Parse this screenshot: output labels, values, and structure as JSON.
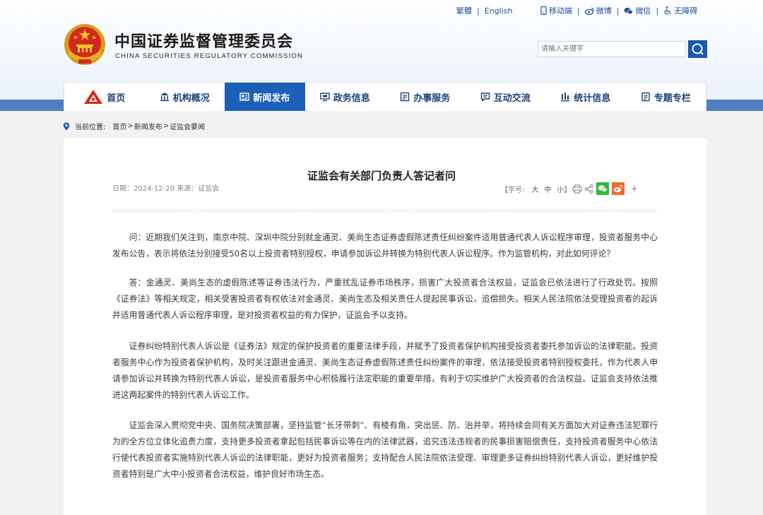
{
  "top_links": {
    "traditional": "繁體",
    "english": "English",
    "mobile": "移动端",
    "weibo": "微博",
    "wechat": "微信",
    "accessibility": "无障碍"
  },
  "site": {
    "title": "中国证券监督管理委员会",
    "subtitle": "CHINA SECURITIES REGULATORY COMMISSION"
  },
  "search": {
    "placeholder": "请输入关键字"
  },
  "nav": [
    {
      "label": "首页",
      "icon": "home-logo-icon"
    },
    {
      "label": "机构概况",
      "icon": "building-icon"
    },
    {
      "label": "新闻发布",
      "icon": "news-icon",
      "active": true
    },
    {
      "label": "政务信息",
      "icon": "monitor-icon"
    },
    {
      "label": "办事服务",
      "icon": "service-icon"
    },
    {
      "label": "互动交流",
      "icon": "chat-icon"
    },
    {
      "label": "统计信息",
      "icon": "bar-chart-icon"
    },
    {
      "label": "专题专栏",
      "icon": "document-icon"
    }
  ],
  "breadcrumb": {
    "prefix": "当前位置:",
    "home": "首页",
    "sep1": ">",
    "news": "新闻发布",
    "sep2": ">",
    "current": "证监会要闻"
  },
  "article": {
    "title": "证监会有关部门负责人答记者问",
    "meta": "日期：2024-12-20 来源：证监会",
    "font_size_label": "【字号:",
    "font_large": "大",
    "font_medium": "中",
    "font_small": "小",
    "font_close": "】",
    "share_more": "+",
    "paragraphs": [
      "问：近期我们关注到，南京中院、深圳中院分别就金通灵、美尚生态证券虚假陈述责任纠纷案件适用普通代表人诉讼程序审理，投资者服务中心发布公告，表示将依法分别接受50名以上投资者特别授权，申请参加诉讼并转换为特别代表人诉讼程序。作为监管机构，对此如何评论？",
      "答：金通灵、美尚生态的虚假陈述等证券违法行为，严重扰乱证券市场秩序，损害广大投资者合法权益，证监会已依法进行了行政处罚。按照《证券法》等相关规定，相关受害投资者有权依法对金通灵、美尚生态及相关责任人提起民事诉讼，追偿损失。相关人民法院依法受理投资者的起诉并适用普通代表人诉讼程序审理，是对投资者权益的有力保护，证监会予以支持。",
      "证券纠纷特别代表人诉讼是《证券法》规定的保护投资者的重要法律手段，并赋予了投资者保护机构接受投资者委托参加诉讼的法律职能。投资者服务中心作为投资者保护机构，及时关注跟进金通灵、美尚生态证券虚假陈述责任纠纷案件的审理，依法接受投资者特别授权委托，作为代表人申请参加诉讼并转换为特别代表人诉讼，是投资者服务中心积极履行法定职能的重要举措，有利于切实维护广大投资者的合法权益。证监会支持依法推进这两起案件的特别代表人诉讼工作。",
      "证监会深入贯彻党中央、国务院决策部署，坚持监管“长牙带刺”、有棱有角，突出惩、防、治并举，将持续会同有关方面加大对证券违法犯罪行为的全方位立体化追责力度，支持更多投资者拿起包括民事诉讼等在内的法律武器，追究违法违规者的民事损害赔偿责任，支持投资者服务中心依法行使代表投资者实施特别代表人诉讼的法律职能，更好为投资者服务；支持配合人民法院依法受理、审理更多证券纠纷特别代表人诉讼，更好维护投资者特别是广大中小投资者合法权益，维护良好市场生态。"
    ]
  },
  "colors": {
    "brand_blue": "#1b5fb8",
    "nav_band": "#4f7fc3",
    "wechat_green": "#2dbb3c",
    "weibo_orange": "#f06a2b"
  }
}
